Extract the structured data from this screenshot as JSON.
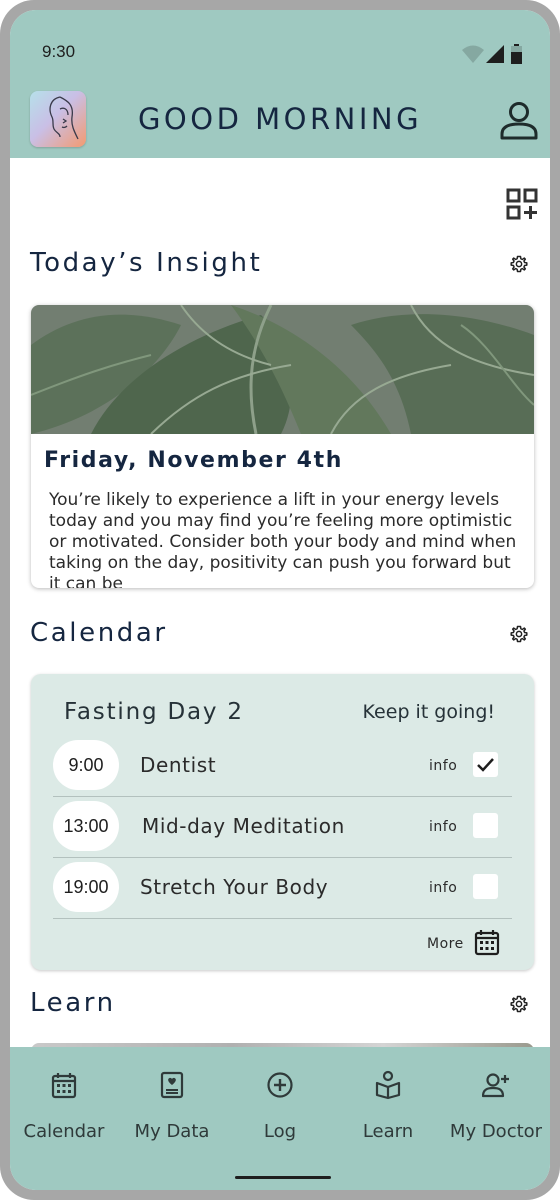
{
  "status_bar": {
    "time": "9:30",
    "wifi_icon": "wifi-icon",
    "signal_icon": "signal-icon",
    "battery_icon": "battery-icon"
  },
  "header": {
    "greeting": "GOOD MORNING",
    "logo_icon": "face-line-art-logo",
    "profile_icon": "person-icon"
  },
  "add_widget_icon": "grid-add-icon",
  "insight": {
    "title": "Today’s Insight",
    "settings_icon": "gear-icon",
    "image": "monstera-leaves-photo",
    "date": "Friday, November 4th",
    "text": "You’re likely to experience a lift in your energy levels today and you may find you’re feeling more optimistic or motivated. Consider both your body and mind when taking on the day, positivity can push you forward but it can be"
  },
  "calendar": {
    "title": "Calendar",
    "settings_icon": "gear-icon",
    "heading": "Fasting Day 2",
    "motto": "Keep it going!",
    "events": [
      {
        "time": "9:00",
        "name": "Dentist",
        "info": "info",
        "checked": true
      },
      {
        "time": "13:00",
        "name": "Mid-day Meditation",
        "info": "info",
        "checked": false
      },
      {
        "time": "19:00",
        "name": "Stretch Your Body",
        "info": "info",
        "checked": false
      }
    ],
    "more_label": "More",
    "more_icon": "calendar-icon"
  },
  "learn": {
    "title": "Learn",
    "settings_icon": "gear-icon"
  },
  "bottom_nav": [
    {
      "label": "Calendar",
      "icon": "calendar-icon"
    },
    {
      "label": "My Data",
      "icon": "data-card-icon"
    },
    {
      "label": "Log",
      "icon": "plus-circle-icon"
    },
    {
      "label": "Learn",
      "icon": "book-reader-icon"
    },
    {
      "label": "My Doctor",
      "icon": "add-person-icon"
    }
  ],
  "colors": {
    "accent": "#9fc9c1",
    "card_tint": "#dceae6",
    "title_text": "#152640",
    "frame": "#a7a7a7"
  }
}
